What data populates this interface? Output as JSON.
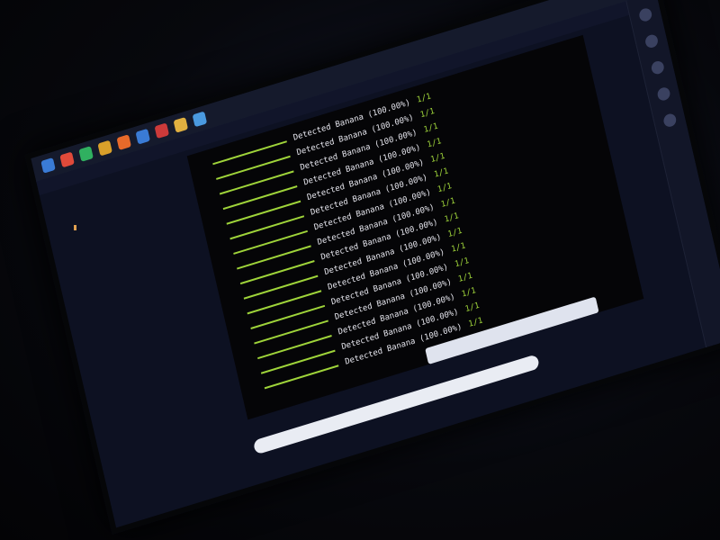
{
  "terminal": {
    "lines": [
      {
        "path": "",
        "status": "",
        "detect": "Detected Banana (100.00%)",
        "ratio": "1/1",
        "bar": 0.95
      },
      {
        "path": "",
        "status": "",
        "detect": "Detected Banana (100.00%)",
        "ratio": "1/1",
        "bar": 0.95
      },
      {
        "path": "",
        "status": "",
        "detect": "Detected Banana (100.00%)",
        "ratio": "1/1",
        "bar": 0.95
      },
      {
        "path": "",
        "status": "",
        "detect": "Detected Banana (100.00%)",
        "ratio": "1/1",
        "bar": 0.95
      },
      {
        "path": "",
        "status": "",
        "detect": "Detected Banana (100.00%)",
        "ratio": "1/1",
        "bar": 0.95
      },
      {
        "path": "",
        "status": "",
        "detect": "Detected Banana (100.00%)",
        "ratio": "1/1",
        "bar": 0.95
      },
      {
        "path": "",
        "status": "",
        "detect": "Detected Banana (100.00%)",
        "ratio": "1/1",
        "bar": 0.95
      },
      {
        "path": "",
        "status": "",
        "detect": "Detected Banana (100.00%)",
        "ratio": "1/1",
        "bar": 0.95
      },
      {
        "path": "",
        "status": "",
        "detect": "Detected Banana (100.00%)",
        "ratio": "1/1",
        "bar": 0.95
      },
      {
        "path": "",
        "status": "",
        "detect": "Detected Banana (100.00%)",
        "ratio": "1/1",
        "bar": 0.95
      },
      {
        "path": "",
        "status": "",
        "detect": "Detected Banana (100.00%)",
        "ratio": "1/1",
        "bar": 0.95
      },
      {
        "path": "",
        "status": "",
        "detect": "Detected Banana (100.00%)",
        "ratio": "1/1",
        "bar": 0.95
      },
      {
        "path": "",
        "status": "",
        "detect": "Detected Banana (100.00%)",
        "ratio": "1/1",
        "bar": 0.95
      },
      {
        "path": "",
        "status": "",
        "detect": "Detected Banana (100.00%)",
        "ratio": "1/1",
        "bar": 0.95
      },
      {
        "path": "",
        "status": "",
        "detect": "Detected Banana (100.00%)",
        "ratio": "1/1",
        "bar": 0.95
      },
      {
        "path": "",
        "status": "",
        "detect": "Detected Banana (100.00%)",
        "ratio": "1/1",
        "bar": 0.95
      }
    ]
  },
  "colors": {
    "progress": "#9fd43a",
    "background": "#0d1122"
  },
  "taskbar_icons": [
    {
      "name": "app-icon",
      "color": "#3a7bd5"
    },
    {
      "name": "app-icon",
      "color": "#e04a3a"
    },
    {
      "name": "app-icon",
      "color": "#30b060"
    },
    {
      "name": "app-icon",
      "color": "#d9a02a"
    },
    {
      "name": "app-icon",
      "color": "#e86a2a"
    },
    {
      "name": "app-icon",
      "color": "#3a7bd5"
    },
    {
      "name": "app-icon",
      "color": "#cc3a3a"
    },
    {
      "name": "app-icon",
      "color": "#e0b040"
    },
    {
      "name": "app-icon",
      "color": "#4a9ae0"
    }
  ]
}
